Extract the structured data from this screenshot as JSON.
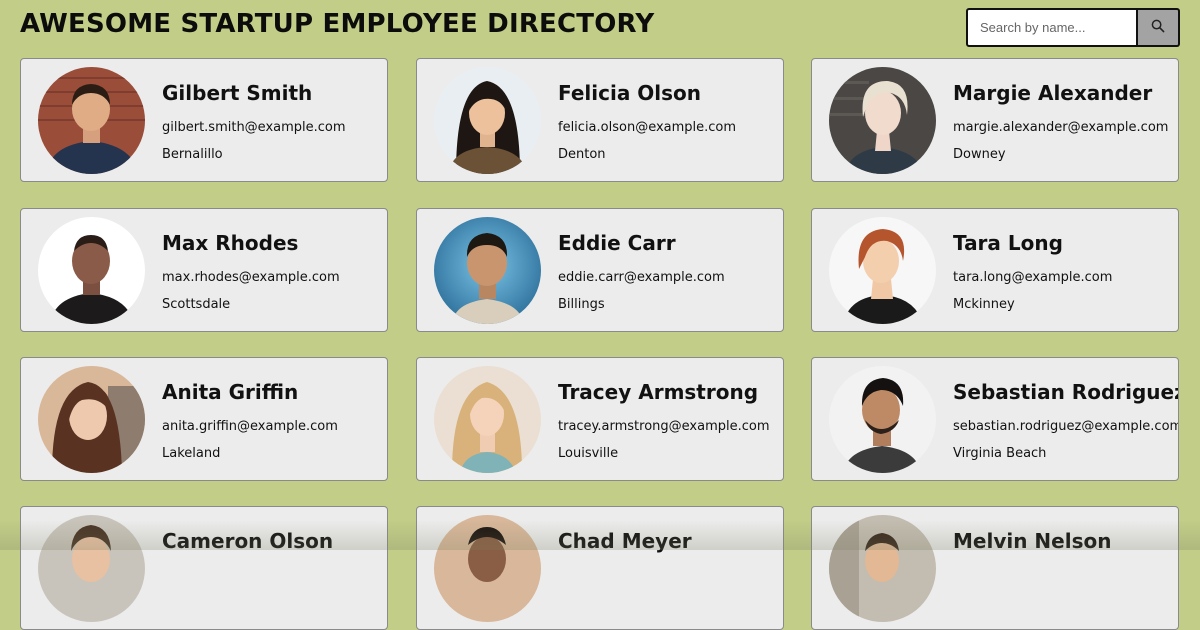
{
  "header": {
    "title": "AWESOME STARTUP EMPLOYEE DIRECTORY"
  },
  "search": {
    "placeholder": "Search by name...",
    "icon": "search-icon"
  },
  "colors": {
    "background": "#c2cd88",
    "card": "#ececec",
    "search_button": "#a3a3a3"
  },
  "employees": [
    {
      "name": "Gilbert Smith",
      "email": "gilbert.smith@example.com",
      "city": "Bernalillo"
    },
    {
      "name": "Felicia Olson",
      "email": "felicia.olson@example.com",
      "city": "Denton"
    },
    {
      "name": "Margie Alexander",
      "email": "margie.alexander@example.com",
      "city": "Downey"
    },
    {
      "name": "Max Rhodes",
      "email": "max.rhodes@example.com",
      "city": "Scottsdale"
    },
    {
      "name": "Eddie Carr",
      "email": "eddie.carr@example.com",
      "city": "Billings"
    },
    {
      "name": "Tara Long",
      "email": "tara.long@example.com",
      "city": "Mckinney"
    },
    {
      "name": "Anita Griffin",
      "email": "anita.griffin@example.com",
      "city": "Lakeland"
    },
    {
      "name": "Tracey Armstrong",
      "email": "tracey.armstrong@example.com",
      "city": "Louisville"
    },
    {
      "name": "Sebastian Rodriguez",
      "email": "sebastian.rodriguez@example.com",
      "city": "Virginia Beach"
    },
    {
      "name": "Cameron Olson",
      "email": "",
      "city": ""
    },
    {
      "name": "Chad Meyer",
      "email": "",
      "city": ""
    },
    {
      "name": "Melvin Nelson",
      "email": "",
      "city": ""
    }
  ]
}
